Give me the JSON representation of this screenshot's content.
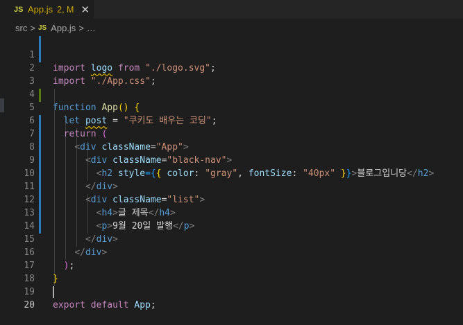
{
  "tab": {
    "icon": "JS",
    "filename": "App.js",
    "badge": "2, M",
    "close": "✕"
  },
  "breadcrumb": {
    "folder": "src",
    "separator": ">",
    "icon": "JS",
    "file": "App.js",
    "symbol": "…"
  },
  "editor": {
    "active_line": 20,
    "lines": [
      {
        "n": "1"
      },
      {
        "n": "2"
      },
      {
        "n": "3"
      },
      {
        "n": "4"
      },
      {
        "n": "5"
      },
      {
        "n": "6"
      },
      {
        "n": "7"
      },
      {
        "n": "8"
      },
      {
        "n": "9"
      },
      {
        "n": "10"
      },
      {
        "n": "11"
      },
      {
        "n": "12"
      },
      {
        "n": "13"
      },
      {
        "n": "14"
      },
      {
        "n": "15"
      },
      {
        "n": "16"
      },
      {
        "n": "17"
      },
      {
        "n": "18"
      },
      {
        "n": "19"
      },
      {
        "n": "20"
      }
    ],
    "code": {
      "l1": [
        "import",
        "logo",
        "from",
        "\"./logo.svg\"",
        ";"
      ],
      "l2": [
        "import",
        "\"./App.css\"",
        ";"
      ],
      "l4": [
        "function",
        "App",
        "()",
        "{"
      ],
      "l5": [
        "let",
        "post",
        "=",
        "\"쿠키도 배우는 코딩\"",
        ";"
      ],
      "l6": [
        "return",
        "("
      ],
      "l7": [
        "<",
        "div",
        "className",
        "=",
        "\"App\"",
        ">"
      ],
      "l8": [
        "<",
        "div",
        "className",
        "=",
        "\"black-nav\"",
        ">"
      ],
      "l9": [
        "<",
        "h2",
        "style",
        "={",
        "{",
        "color",
        ":",
        "\"gray\"",
        ",",
        "fontSize",
        ":",
        "\"40px\"",
        "}",
        "}",
        ">",
        "블로그입니당",
        "</",
        "h2",
        ">"
      ],
      "l10": [
        "</",
        "div",
        ">"
      ],
      "l11": [
        "<",
        "div",
        "className",
        "=",
        "\"list\"",
        ">"
      ],
      "l12": [
        "<",
        "h4",
        ">",
        "글 제목",
        "</",
        "h4",
        ">"
      ],
      "l13": [
        "<",
        "p",
        ">",
        "9월 20일 발행",
        "</",
        "p",
        ">"
      ],
      "l14": [
        "</",
        "div",
        ">"
      ],
      "l15": [
        "</",
        "div",
        ">"
      ],
      "l16": [
        ")",
        ";"
      ],
      "l17": [
        "}"
      ],
      "l19": [
        "export",
        "default",
        "App",
        ";"
      ]
    }
  },
  "colors": {
    "background": "#1e1e1e",
    "keyword_control": "#c586c0",
    "keyword": "#569cd6",
    "function": "#dcdcaa",
    "variable": "#9cdcfe",
    "string": "#ce9178",
    "modified_tab": "#cca700"
  }
}
